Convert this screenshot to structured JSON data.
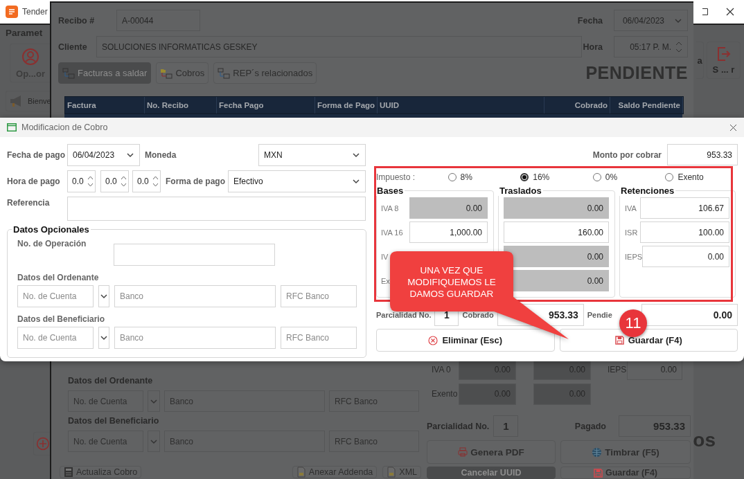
{
  "app_window": {
    "title": "Tender",
    "section_title": "Paramet",
    "side_button": "Op...or",
    "tab": "Bienve",
    "right_buttons": [
      "a",
      "S ... r"
    ],
    "corner_text": "os"
  },
  "receipt_window": {
    "recibo_label": "Recibo #",
    "recibo": "A-00044",
    "fecha_label": "Fecha",
    "fecha": "06/04/2023",
    "cliente_label": "Cliente",
    "cliente": "SOLUCIONES INFORMATICAS GESKEY",
    "hora_label": "Hora",
    "hora": "05:17 P. M.",
    "toolbar": [
      {
        "label": "Facturas a saldar",
        "disabled": true
      },
      {
        "label": "Cobros",
        "disabled": false
      },
      {
        "label": "REP´s relacionados",
        "disabled": false
      }
    ],
    "status": "PENDIENTE",
    "table": {
      "columns": [
        "Factura",
        "No. Recibo",
        "Fecha Pago",
        "Forma de Pago",
        "UUID",
        "Cobrado",
        "Saldo Pendiente"
      ]
    },
    "ordenante_label": "Datos del Ordenante",
    "ordenante": {
      "cuenta_placeholder": "No. de Cuenta",
      "banco_placeholder": "Banco",
      "rfc_placeholder": "RFC Banco"
    },
    "beneficiario_label": "Datos del Beneficiario",
    "beneficiario": {
      "cuenta_placeholder": "No. de Cuenta",
      "banco_placeholder": "Banco",
      "rfc_placeholder": "RFC Banco"
    },
    "tax_rows": [
      {
        "label": "IVA 0",
        "base": "0.00",
        "traslado": "0.00",
        "retencion_label": "IEPS",
        "retencion": "0.00"
      },
      {
        "label": "Exento",
        "base": "0.00",
        "traslado": "0.00"
      }
    ],
    "parcialidad_label": "Parcialidad No.",
    "parcialidad": "1",
    "pagado_label": "Pagado",
    "pagado": "953.33",
    "buttons": [
      {
        "label": "Genera PDF",
        "disabled": false
      },
      {
        "label": "Timbrar (F5)",
        "disabled": false
      },
      {
        "label": "Cancelar UUID",
        "disabled": true
      },
      {
        "label": "Guardar (F4)",
        "disabled": false
      }
    ],
    "footer_buttons": [
      "Actualiza Cobro",
      "Anexar Addenda",
      "XML"
    ]
  },
  "dialog": {
    "title": "Modificacion de Cobro",
    "fecha_pago_label": "Fecha de pago",
    "fecha_pago": "06/04/2023",
    "moneda_label": "Moneda",
    "moneda": "MXN",
    "hora_pago_label": "Hora de pago",
    "hora_pago": [
      "0.0",
      "0.0",
      "0.0"
    ],
    "forma_pago_label": "Forma de pago",
    "forma_pago": "Efectivo",
    "referencia_label": "Referencia",
    "opcionales": {
      "title": "Datos Opcionales",
      "operacion_label": "No. de Operación",
      "ordenante_label": "Datos del Ordenante",
      "ordenante": {
        "cuenta_placeholder": "No. de Cuenta",
        "banco_placeholder": "Banco",
        "rfc_placeholder": "RFC Banco"
      },
      "beneficiario_label": "Datos del Beneficiario",
      "beneficiario": {
        "cuenta_placeholder": "No. de Cuenta",
        "banco_placeholder": "Banco",
        "rfc_placeholder": "RFC Banco"
      }
    },
    "monto_label": "Monto por cobrar",
    "monto": "953.33",
    "impuesto": {
      "label": "Impuesto :",
      "options": [
        {
          "label": "8%",
          "selected": false
        },
        {
          "label": "16%",
          "selected": true
        },
        {
          "label": "0%",
          "selected": false
        },
        {
          "label": "Exento",
          "selected": false
        }
      ]
    },
    "groups": [
      {
        "title": "Bases",
        "rows": [
          {
            "label": "IVA 8",
            "value": "0.00",
            "disabled": true
          },
          {
            "label": "IVA 16",
            "value": "1,000.00",
            "disabled": false
          },
          {
            "label": "IV"
          },
          {
            "label": "Ex"
          }
        ]
      },
      {
        "title": "Traslados",
        "rows": [
          {
            "value": "0.00",
            "disabled": true
          },
          {
            "value": "160.00",
            "disabled": false
          },
          {
            "value": "0.00",
            "disabled": true
          },
          {
            "value": "0.00",
            "disabled": true
          }
        ]
      },
      {
        "title": "Retenciones",
        "rows": [
          {
            "label": "IVA",
            "value": "106.67",
            "disabled": false
          },
          {
            "label": "ISR",
            "value": "100.00",
            "disabled": false
          },
          {
            "label": "IEPS",
            "value": "0.00",
            "disabled": false
          }
        ]
      }
    ],
    "parcialidad_label": "Parcialidad No.",
    "parcialidad": "1",
    "cobrado_label": "Cobrado",
    "cobrado": "953.33",
    "pendiente_label": "Pendie",
    "pendiente": "0.00",
    "buttons": [
      "Eliminar (Esc)",
      "Guardar (F4)"
    ]
  },
  "annotation": {
    "callout": "UNA VEZ QUE MODIFIQUEMOS LE DAMOS GUARDAR",
    "step": "11"
  }
}
